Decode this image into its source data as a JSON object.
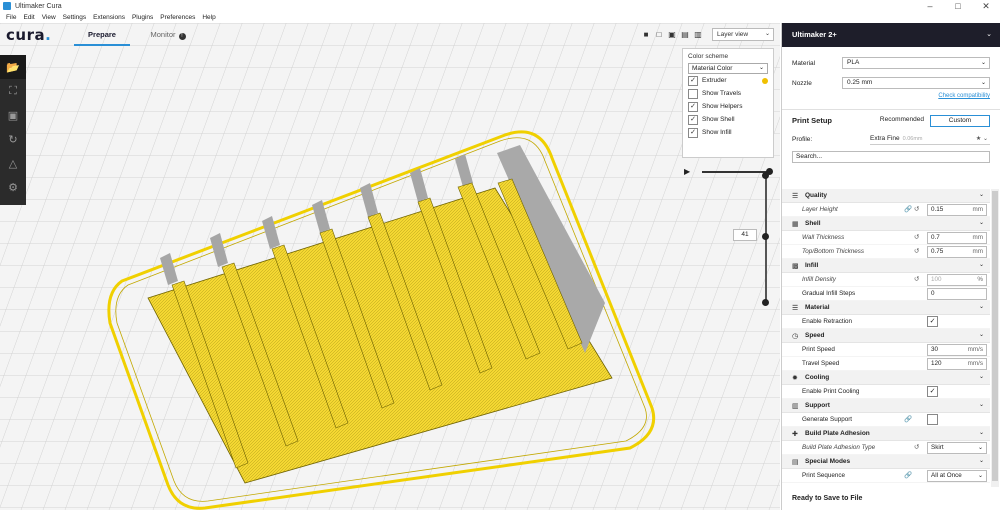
{
  "window": {
    "title": "Ultimaker Cura"
  },
  "menu": [
    "File",
    "Edit",
    "View",
    "Settings",
    "Extensions",
    "Plugins",
    "Preferences",
    "Help"
  ],
  "header": {
    "logo": "cura",
    "tabs": {
      "prepare": "Prepare",
      "monitor": "Monitor"
    }
  },
  "view": {
    "mode": "Layer view",
    "layer_number": "41"
  },
  "color_panel": {
    "label": "Color scheme",
    "scheme": "Material Color",
    "options": [
      {
        "label": "Extruder",
        "checked": true
      },
      {
        "label": "Show Travels",
        "checked": false
      },
      {
        "label": "Show Helpers",
        "checked": true
      },
      {
        "label": "Show Shell",
        "checked": true
      },
      {
        "label": "Show Infill",
        "checked": true
      }
    ]
  },
  "sidebar": {
    "printer": "Ultimaker 2+",
    "material_label": "Material",
    "material": "PLA",
    "nozzle_label": "Nozzle",
    "nozzle": "0.25 mm",
    "compat": "Check compatibility",
    "print_setup": "Print Setup",
    "mode_recommended": "Recommended",
    "mode_custom": "Custom",
    "profile_label": "Profile:",
    "profile": "Extra Fine",
    "profile_sub": "0.06mm",
    "search_placeholder": "Search...",
    "ready": "Ready to Save to File"
  },
  "settings": {
    "quality": {
      "title": "Quality",
      "layer_height_label": "Layer Height",
      "layer_height": "0.15",
      "unit_mm": "mm"
    },
    "shell": {
      "title": "Shell",
      "wall_label": "Wall Thickness",
      "wall": "0.7",
      "topbottom_label": "Top/Bottom Thickness",
      "topbottom": "0.75"
    },
    "infill": {
      "title": "Infill",
      "density_label": "Infill Density",
      "density": "100",
      "unit_pct": "%",
      "gradual_label": "Gradual Infill Steps",
      "gradual": "0"
    },
    "material": {
      "title": "Material",
      "retraction_label": "Enable Retraction"
    },
    "speed": {
      "title": "Speed",
      "print_label": "Print Speed",
      "print": "30",
      "travel_label": "Travel Speed",
      "travel": "120",
      "unit": "mm/s"
    },
    "cooling": {
      "title": "Cooling",
      "fan_label": "Enable Print Cooling"
    },
    "support": {
      "title": "Support",
      "gen_label": "Generate Support"
    },
    "adhesion": {
      "title": "Build Plate Adhesion",
      "type_label": "Build Plate Adhesion Type",
      "type": "Skirt"
    },
    "special": {
      "title": "Special Modes",
      "seq_label": "Print Sequence",
      "seq": "All at Once"
    }
  },
  "colors": {
    "accent": "#2a8fd6",
    "model": "#f5d832",
    "dark": "#1e1e2a"
  }
}
